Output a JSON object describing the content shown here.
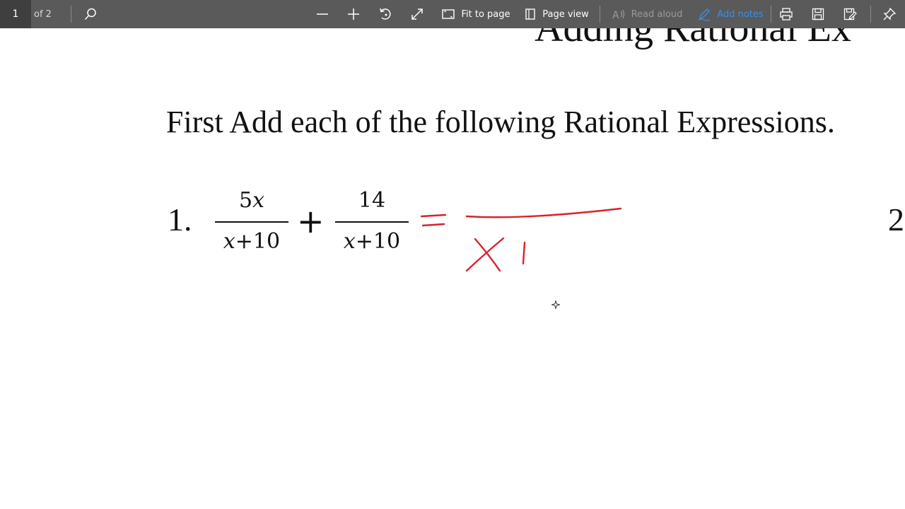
{
  "toolbar": {
    "page_number": "1",
    "page_count": "of 2",
    "buttons": {
      "search_icon": "search-icon",
      "zoom_out_icon": "minus-icon",
      "zoom_in_icon": "plus-icon",
      "rotate_icon": "rotate-icon",
      "fullscreen_icon": "expand-icon",
      "fit_to_page": "Fit to page",
      "page_view": "Page view",
      "read_aloud": "Read aloud",
      "add_notes": "Add notes",
      "print_icon": "printer-icon",
      "save_icon": "save-icon",
      "save_as_icon": "save-as-icon",
      "pin_icon": "pin-icon"
    },
    "colors": {
      "background": "#5a5a5a",
      "page_box": "#3f3f3f",
      "add_notes_accent": "#3a8ee6",
      "disabled": "#9a9a9a"
    }
  },
  "document": {
    "title_partial": "Adding Rational Ex",
    "instructions": "First Add each of the following Rational Expressions.",
    "problem_1": {
      "number": "1.",
      "fraction_1": {
        "numerator": "5x",
        "denominator": "x+10"
      },
      "operator": "+",
      "fraction_2": {
        "numerator": "14",
        "denominator": "x+10"
      }
    },
    "problem_2_number_partial": "2",
    "handwriting": {
      "color": "#d8232a",
      "equals": "=",
      "written_text": "X I"
    }
  }
}
